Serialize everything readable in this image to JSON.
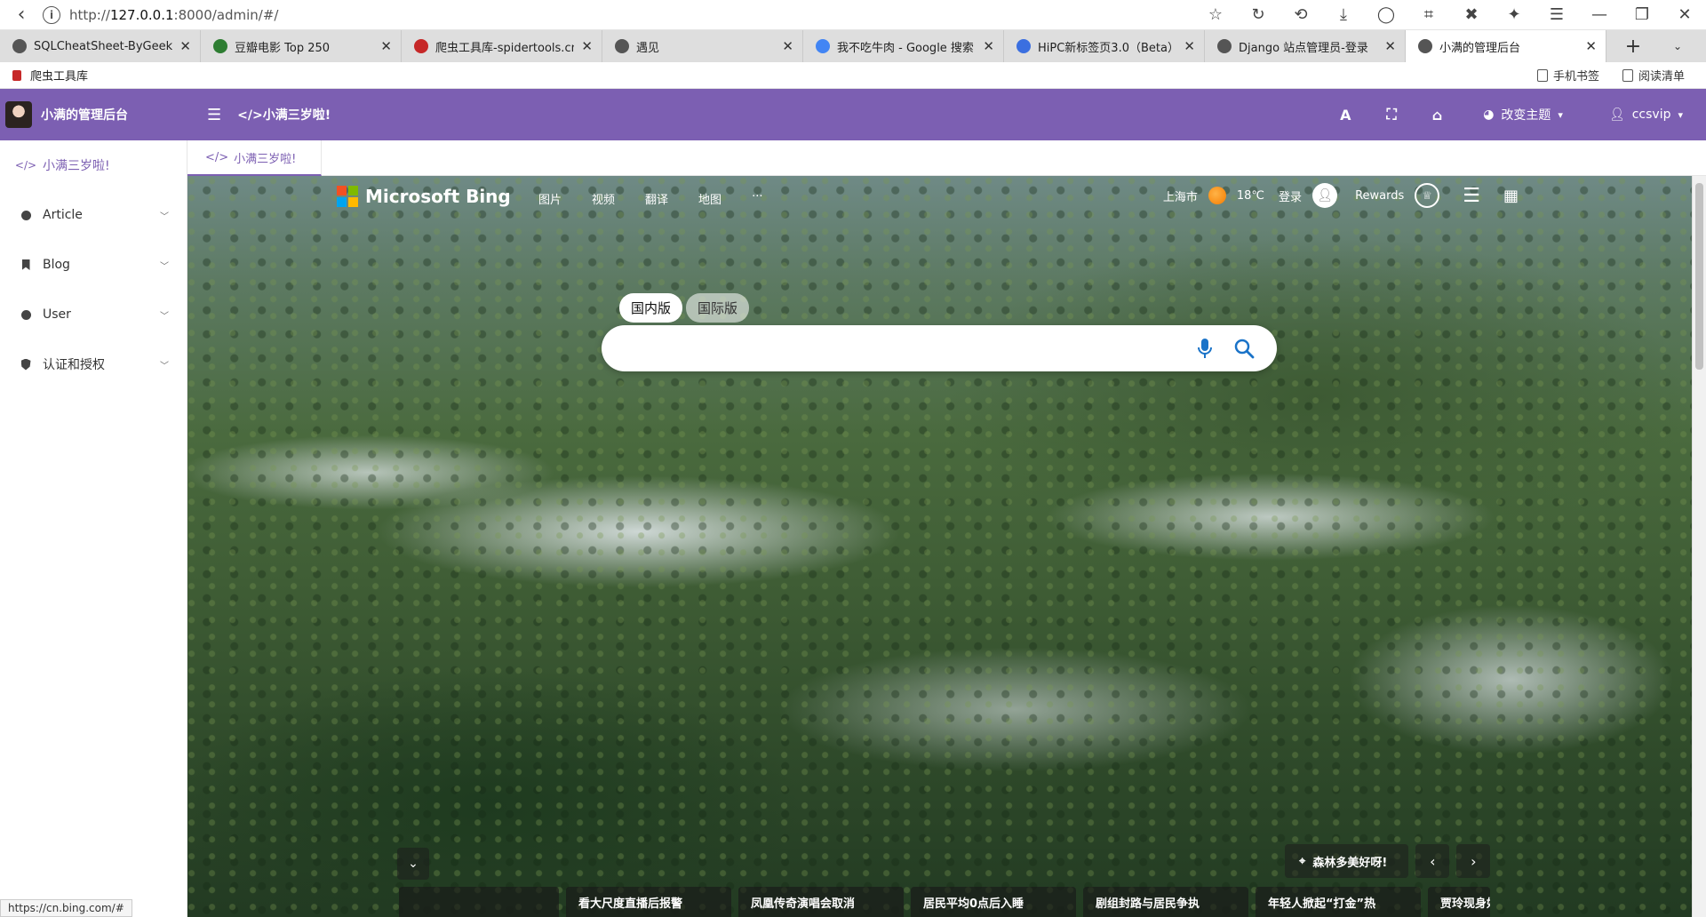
{
  "browser": {
    "url_prefix": "http://",
    "url_host": "127.0.0.1",
    "url_rest": ":8000/admin/#/",
    "tabs": [
      {
        "title": "SQLCheatSheet-ByGeekHo",
        "fav_color": "#555555"
      },
      {
        "title": "豆瓣电影 Top 250",
        "fav_color": "#2e7d32"
      },
      {
        "title": "爬虫工具库-spidertools.cn",
        "fav_color": "#c62828"
      },
      {
        "title": "遇见",
        "fav_color": "#555555"
      },
      {
        "title": "我不吃牛肉 - Google 搜索",
        "fav_color": "#4285f4"
      },
      {
        "title": "HiPC新标签页3.0（Beta）",
        "fav_color": "#3b6fe0"
      },
      {
        "title": "Django 站点管理员-登录",
        "fav_color": "#555555"
      },
      {
        "title": "小满的管理后台",
        "fav_color": "#555555"
      }
    ],
    "new_tab_label": "+",
    "bookmark": "爬虫工具库",
    "mobile_bookmarks": "手机书签",
    "reading_list": "阅读清单",
    "status_url": "https://cn.bing.com/#"
  },
  "admin": {
    "brand_title": "小满的管理后台",
    "header_crumb": "</>小满三岁啦!",
    "change_theme": "改变主题",
    "user": "ccsvip",
    "font_icon": "A",
    "accent": "#7c5fb2"
  },
  "sidebar": {
    "items": [
      {
        "label": "小满三岁啦!"
      },
      {
        "label": "Article"
      },
      {
        "label": "Blog"
      },
      {
        "label": "User"
      },
      {
        "label": "认证和授权"
      }
    ]
  },
  "content_tabs": [
    {
      "label": "小满三岁啦!"
    }
  ],
  "bing": {
    "logo_text": "Microsoft Bing",
    "nav": [
      "图片",
      "视频",
      "翻译",
      "地图",
      "···"
    ],
    "city": "上海市",
    "temp": "18℃",
    "login": "登录",
    "rewards": "Rewards",
    "toggle_domestic": "国内版",
    "toggle_intl": "国际版",
    "search_placeholder": "",
    "caption": "森林多美好呀!",
    "news": [
      "",
      "看大尺度直播后报警",
      "凤凰传奇演唱会取消",
      "居民平均0点后入睡",
      "剧组封路与居民争执",
      "年轻人掀起“打金”热",
      "贾玲现身好"
    ]
  }
}
